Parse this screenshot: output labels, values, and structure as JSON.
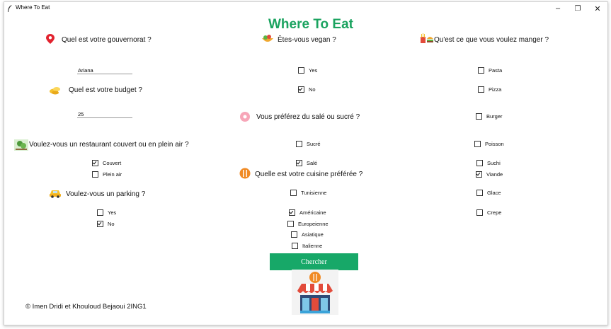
{
  "window": {
    "title": "Where To Eat",
    "controls": [
      "–",
      "❐",
      "✕"
    ]
  },
  "heading": "Where To Eat",
  "governorate": {
    "question": "Quel est votre gouvernorat ?",
    "value": "Ariana",
    "icon": "map-pin-icon"
  },
  "budget": {
    "question": "Quel est votre budget ?",
    "value": "25",
    "icon": "coins-icon"
  },
  "outdoor": {
    "question": "Voulez-vous un restaurant couvert ou en plein air ?",
    "icon": "park-icon",
    "options": [
      {
        "label": "Couvert",
        "checked": true
      },
      {
        "label": "Plein air",
        "checked": false
      }
    ]
  },
  "parking": {
    "question": "Voulez-vous un parking ?",
    "icon": "car-icon",
    "options": [
      {
        "label": "Yes",
        "checked": false
      },
      {
        "label": "No",
        "checked": true
      }
    ]
  },
  "vegan": {
    "question": "Êtes-vous vegan ?",
    "icon": "salad-icon",
    "options": [
      {
        "label": "Yes",
        "checked": false
      },
      {
        "label": "No",
        "checked": true
      }
    ]
  },
  "taste": {
    "question": "Vous préférez du salé ou sucré ?",
    "icon": "donut-icon",
    "options": [
      {
        "label": "Sucré",
        "checked": false
      },
      {
        "label": "Salé",
        "checked": true
      }
    ]
  },
  "cuisine": {
    "question": "Quelle est votre cuisine préférée ?",
    "icon": "cutlery-icon",
    "options": [
      {
        "label": "Tunisienne",
        "checked": false
      },
      {
        "label": "Américaine",
        "checked": true
      },
      {
        "label": "Europeienne",
        "checked": false
      },
      {
        "label": "Asiatique",
        "checked": false
      },
      {
        "label": "Italienne",
        "checked": false
      }
    ]
  },
  "food": {
    "question": "Qu'est ce que vous voulez manger ?",
    "icon": "fast-food-icon",
    "options": [
      {
        "label": "Pasta",
        "checked": false
      },
      {
        "label": "Pizza",
        "checked": false
      },
      {
        "label": "Burger",
        "checked": false
      },
      {
        "label": "Poisson",
        "checked": false
      },
      {
        "label": "Suchi",
        "checked": false
      },
      {
        "label": "Viande",
        "checked": true
      },
      {
        "label": "Glace",
        "checked": false
      },
      {
        "label": "Crepe",
        "checked": false
      }
    ]
  },
  "search_button": "Chercher",
  "footer": "© Imen Dridi et Khouloud Bejaoui 2ING1",
  "colors": {
    "accent": "#1aa35f",
    "button": "#17a868"
  }
}
